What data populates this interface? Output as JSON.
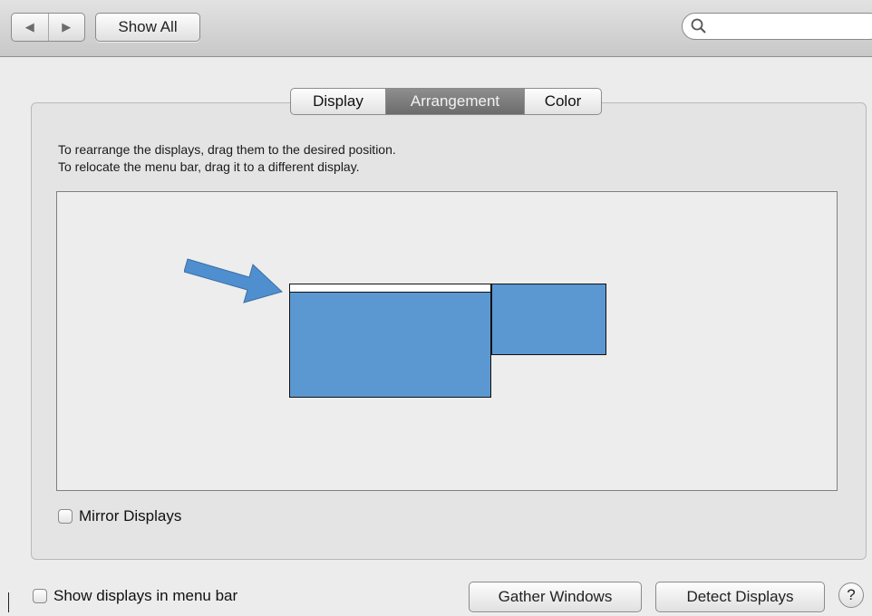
{
  "toolbar": {
    "back_icon": "back-arrow-icon",
    "forward_icon": "forward-arrow-icon",
    "show_all_label": "Show All",
    "search": {
      "value": "",
      "placeholder": "",
      "icon": "search-icon"
    }
  },
  "tabs": [
    {
      "label": "Display",
      "selected": false
    },
    {
      "label": "Arrangement",
      "selected": true
    },
    {
      "label": "Color",
      "selected": false
    }
  ],
  "instructions": {
    "line1": "To rearrange the displays, drag them to the desired position.",
    "line2": "To relocate the menu bar, drag it to a different display."
  },
  "arrangement": {
    "display_color": "#5b97d1",
    "displays": [
      {
        "name": "main-display",
        "has_menu_bar": true
      },
      {
        "name": "secondary-display",
        "has_menu_bar": false
      }
    ],
    "annotation_arrow_color": "#4f8fcf"
  },
  "mirror_displays": {
    "label": "Mirror Displays",
    "checked": false
  },
  "footer": {
    "show_in_menu_bar": {
      "label": "Show displays in menu bar",
      "checked": false
    },
    "gather_label": "Gather Windows",
    "detect_label": "Detect Displays",
    "help_label": "?"
  }
}
